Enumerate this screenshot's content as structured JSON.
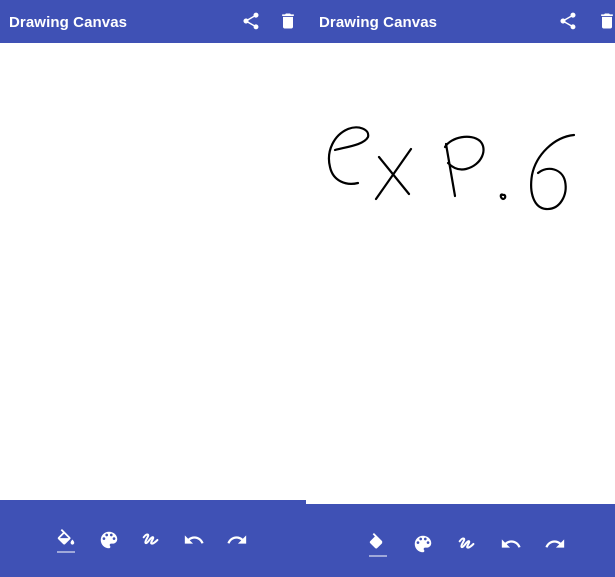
{
  "screens": [
    {
      "app_bar": {
        "title": "Drawing Canvas",
        "share_icon": "share-icon",
        "delete_icon": "delete-icon"
      },
      "canvas": {
        "state": "blank"
      },
      "toolbar": {
        "tools": [
          "fill-bucket-icon",
          "palette-icon",
          "brush-stroke-icon",
          "undo-icon",
          "redo-icon"
        ],
        "active_tool": "fill-bucket-icon"
      }
    },
    {
      "app_bar": {
        "title": "Drawing Canvas",
        "share_icon": "share-icon",
        "delete_icon": "delete-icon"
      },
      "canvas": {
        "state": "handwritten strokes"
      },
      "toolbar": {
        "tools": [
          "fill-bucket-icon",
          "palette-icon",
          "brush-stroke-icon",
          "undo-icon",
          "redo-icon"
        ],
        "active_tool": "fill-bucket-icon"
      }
    }
  ],
  "colors": {
    "app_bar": "#3f51b5",
    "toolbar": "#3f51b5",
    "icon": "#ffffff",
    "canvas": "#ffffff",
    "ink": "#000000",
    "active_underline": "#9fa8da"
  }
}
